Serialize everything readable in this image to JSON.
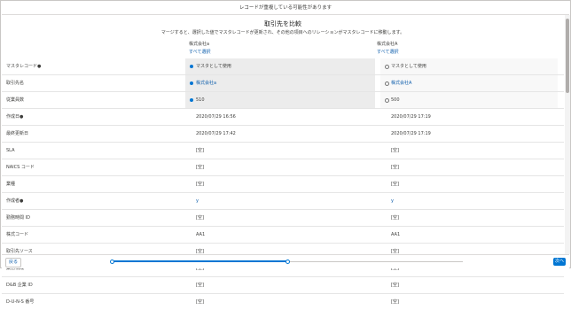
{
  "banner": {
    "text": "レコードが重複している可能性があります"
  },
  "header": {
    "title": "取引先を比較",
    "subtitle": "マージすると、選択した値でマスタレコードが更新され、その他の項目へのリレーションがマスタレコードに移動します。"
  },
  "columns": [
    {
      "name": "株式会社a",
      "select_all": "すべて選択"
    },
    {
      "name": "株式会社A",
      "select_all": "すべて選択"
    }
  ],
  "rows": [
    {
      "label": "マスタレコード●",
      "v1": "マスタとして使用",
      "v2": "マスタとして使用"
    },
    {
      "label": "取引先名",
      "v1": "株式会社a",
      "v2": "株式会社A"
    },
    {
      "label": "従業員数",
      "v1": "510",
      "v2": "500"
    },
    {
      "label": "作成日●",
      "v1": "2020/07/29 16:56",
      "v2": "2020/07/29 17:19"
    },
    {
      "label": "最終更新日",
      "v1": "2020/07/29 17:42",
      "v2": "2020/07/29 17:19"
    },
    {
      "label": "SLA",
      "v1": "[空]",
      "v2": "[空]"
    },
    {
      "label": "NAICS コード",
      "v1": "[空]",
      "v2": "[空]"
    },
    {
      "label": "業種",
      "v1": "[空]",
      "v2": "[空]"
    },
    {
      "label": "作成者●",
      "v1": "y",
      "v2": "y"
    },
    {
      "label": "勤務時間 ID",
      "v1": "[空]",
      "v2": "[空]"
    },
    {
      "label": "株式コード",
      "v1": "AA1",
      "v2": "AA1"
    },
    {
      "label": "取引先ソース",
      "v1": "[空]",
      "v2": "[空]"
    },
    {
      "label": "業務構成",
      "v1": "[空]",
      "v2": "[空]"
    },
    {
      "label": "D&B 企業 ID",
      "v1": "[空]",
      "v2": "[空]"
    },
    {
      "label": "D-U-N-S 番号",
      "v1": "[空]",
      "v2": "[空]"
    }
  ],
  "footer": {
    "back_label": "戻る",
    "next_label": "次へ",
    "progress_percent": 50
  }
}
